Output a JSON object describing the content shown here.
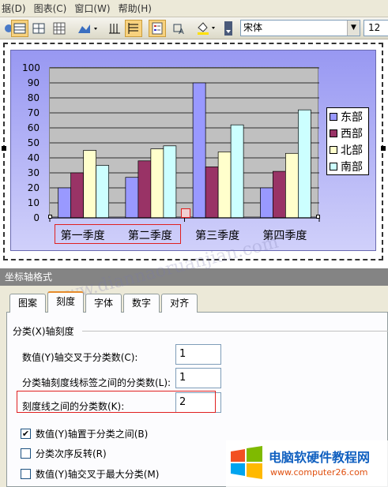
{
  "menubar": {
    "items": [
      "据(D)",
      "图表(C)",
      "窗口(W)",
      "帮助(H)"
    ]
  },
  "toolbar": {
    "font_name": "宋体",
    "font_size": "12"
  },
  "chart_data": {
    "type": "bar",
    "categories": [
      "第一季度",
      "第二季度",
      "第三季度",
      "第四季度"
    ],
    "series": [
      {
        "name": "东部",
        "values": [
          20,
          27,
          90,
          20
        ],
        "color": "#9999ff"
      },
      {
        "name": "西部",
        "values": [
          30,
          38,
          34,
          31
        ],
        "color": "#993366"
      },
      {
        "name": "北部",
        "values": [
          45,
          46,
          44,
          43
        ],
        "color": "#ffffcc"
      },
      {
        "name": "南部",
        "values": [
          35,
          48,
          62,
          72
        ],
        "color": "#ccffff"
      }
    ],
    "ylim": [
      0,
      100
    ],
    "yticks": [
      "100",
      "90",
      "80",
      "70",
      "60",
      "50",
      "40",
      "30",
      "20",
      "10",
      "0"
    ],
    "grid": true,
    "legend_position": "right"
  },
  "dialog": {
    "title": "坐标轴格式",
    "tabs": [
      "图案",
      "刻度",
      "字体",
      "数字",
      "对齐"
    ],
    "active_tab": "刻度",
    "group_label": "分类(X)轴刻度",
    "fields": [
      {
        "label": "数值(Y)轴交叉于分类数(C):",
        "value": "1"
      },
      {
        "label": "分类轴刻度线标签之间的分类数(L):",
        "value": "1"
      },
      {
        "label": "刻度线之间的分类数(K):",
        "value": "2"
      }
    ],
    "checkboxes": [
      {
        "label": "数值(Y)轴置于分类之间(B)",
        "checked": "✔"
      },
      {
        "label": "分类次序反转(R)",
        "checked": ""
      },
      {
        "label": "数值(Y)轴交叉于最大分类(M)",
        "checked": ""
      }
    ]
  },
  "watermark": "www.diannaoruanjian.com",
  "logo": {
    "title": "电脑软硬件教程网",
    "url": "www.computer26.com"
  }
}
